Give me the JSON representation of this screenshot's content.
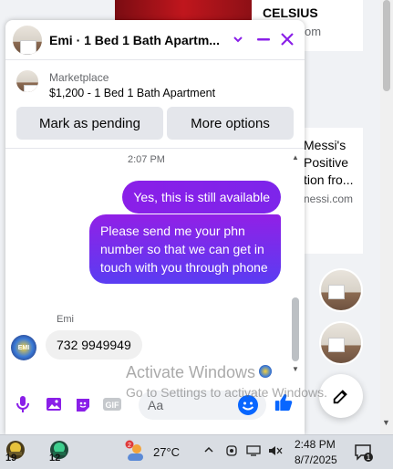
{
  "background_feed": {
    "card_title": "CELSIUS",
    "card_sub": "om",
    "mid_text": "Messi's Positive tion fro...",
    "mid_url": "nessi.com"
  },
  "chat": {
    "title": "Emi · 1 Bed 1 Bath Apartm...",
    "listing": {
      "label": "Marketplace",
      "description": "$1,200 - 1 Bed 1 Bath Apartment",
      "mark_pending": "Mark as pending",
      "more_options": "More options"
    },
    "timestamp": "2:07 PM",
    "messages": [
      {
        "from": "me",
        "text": "Yes, this is still available"
      },
      {
        "from": "me",
        "text": "Please send me your phn number so that we can get in touch with you through phone"
      },
      {
        "from": "Emi",
        "text": "732 9949949"
      }
    ],
    "sender_name": "Emi",
    "avatar_text": "EMI",
    "composer_placeholder": "Aa"
  },
  "watermark": {
    "line1": "Activate Windows",
    "line2": "Go to Settings to activate Windows."
  },
  "taskbar": {
    "app1_badge": "19",
    "app2_badge": "12",
    "temperature": "27°C",
    "time": "2:48 PM",
    "date": "8/7/2025",
    "notification_count": "1",
    "weather_badge": "2"
  },
  "colors": {
    "accent": "#8a1fe8",
    "messenger_blue": "#0866ff"
  }
}
